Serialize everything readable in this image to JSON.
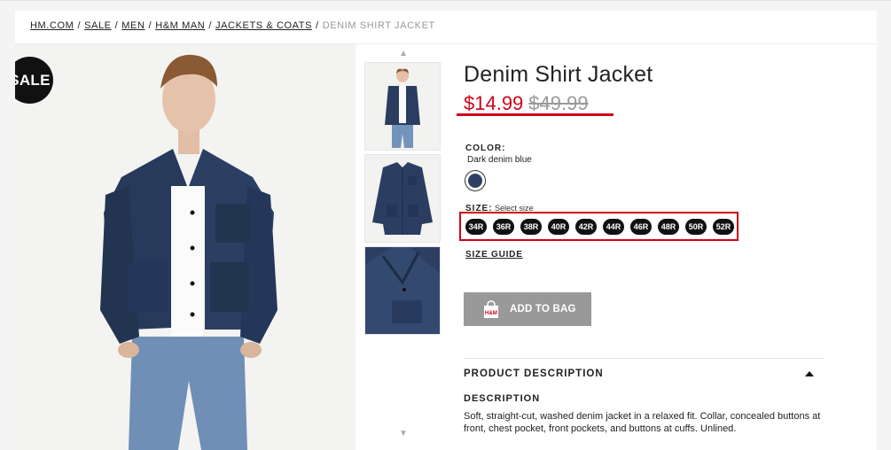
{
  "breadcrumb": {
    "items": [
      "HM.COM",
      "SALE",
      "MEN",
      "H&M MAN",
      "JACKETS & COATS"
    ],
    "current": "DENIM SHIRT JACKET"
  },
  "badge": {
    "label": "SALE"
  },
  "product": {
    "title": "Denim Shirt Jacket",
    "price_sale": "$14.99",
    "price_old": "$49.99",
    "color_label": "COLOR:",
    "color_value": "Dark denim blue",
    "swatch_color": "#2e3f63",
    "size_label": "SIZE:",
    "size_hint": "Select size",
    "sizes": [
      "34R",
      "36R",
      "38R",
      "40R",
      "42R",
      "44R",
      "46R",
      "48R",
      "50R",
      "52R"
    ],
    "size_guide": "SIZE GUIDE",
    "add_to_bag": "ADD TO BAG",
    "bag_icon_text": "H&M"
  },
  "description": {
    "section_title": "PRODUCT DESCRIPTION",
    "subtitle": "DESCRIPTION",
    "text": "Soft, straight-cut, washed denim jacket in a relaxed fit. Collar, concealed buttons at front, chest pocket, front pockets, and buttons at cuffs. Unlined."
  },
  "colors": {
    "sale_red": "#d0021b",
    "denim": "#2e3f63",
    "button_grey": "#999999"
  }
}
